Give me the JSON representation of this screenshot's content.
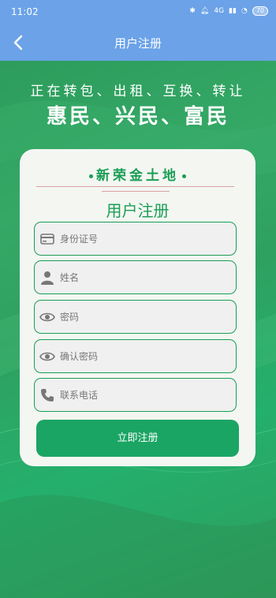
{
  "status_bar": {
    "time": "11:02",
    "signal_text": "4G",
    "battery": "70"
  },
  "nav": {
    "title": "用户注册"
  },
  "slogan": {
    "line1": "正在转包、出租、互换、转让",
    "line2": "惠民、兴民、富民"
  },
  "card": {
    "brand": "新荣金土地",
    "title": "用户注册",
    "fields": [
      {
        "icon": "id-card-icon",
        "placeholder": "身份证号",
        "value": ""
      },
      {
        "icon": "person-icon",
        "placeholder": "姓名",
        "value": ""
      },
      {
        "icon": "eye-icon",
        "placeholder": "密码",
        "value": ""
      },
      {
        "icon": "eye-icon",
        "placeholder": "确认密码",
        "value": ""
      },
      {
        "icon": "phone-icon",
        "placeholder": "联系电话",
        "value": ""
      }
    ],
    "submit_label": "立即注册"
  },
  "colors": {
    "header": "#6ba2e8",
    "accent_green": "#1a9e55",
    "button": "#1aa564",
    "background": "#2e9e5f"
  }
}
